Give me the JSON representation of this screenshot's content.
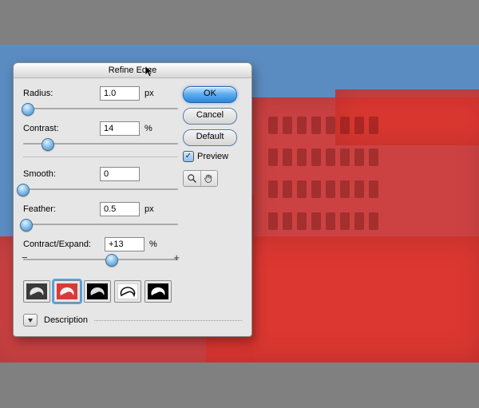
{
  "dialog": {
    "title": "Refine Edge",
    "buttons": {
      "ok": "OK",
      "cancel": "Cancel",
      "default": "Default"
    },
    "preview": {
      "checked": true,
      "label": "Preview"
    },
    "tools": {
      "zoom": "zoom-icon",
      "hand": "hand-icon"
    },
    "controls": {
      "radius": {
        "label": "Radius:",
        "value": "1.0",
        "unit": "px",
        "slider_pct": 3
      },
      "contrast": {
        "label": "Contrast:",
        "value": "14",
        "unit": "%",
        "slider_pct": 16
      },
      "smooth": {
        "label": "Smooth:",
        "value": "0",
        "unit": "",
        "slider_pct": 0
      },
      "feather": {
        "label": "Feather:",
        "value": "0.5",
        "unit": "px",
        "slider_pct": 2
      },
      "expand": {
        "label": "Contract/Expand:",
        "value": "+13",
        "unit": "%",
        "slider_pct": 57,
        "minus": "−",
        "plus": "+"
      }
    },
    "preview_modes": {
      "selected_index": 1,
      "names": [
        "standard",
        "overlay",
        "on-black",
        "on-white",
        "mask"
      ]
    },
    "description_label": "Description"
  }
}
